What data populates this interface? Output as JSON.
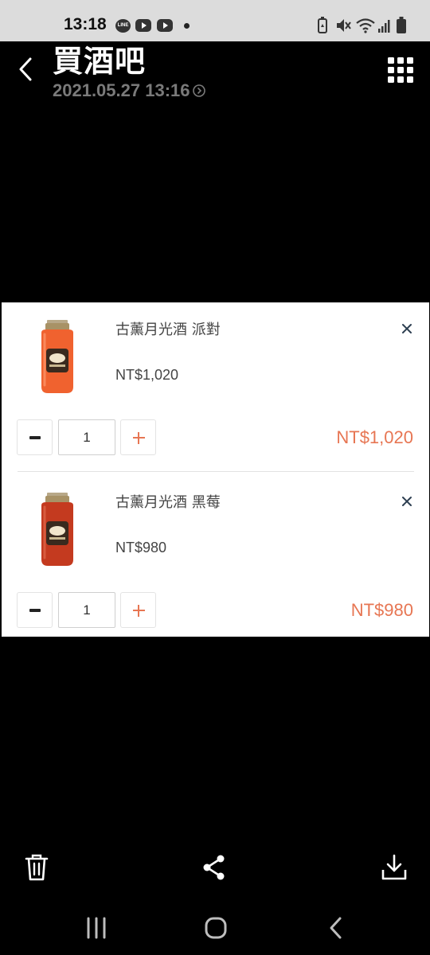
{
  "status_bar": {
    "time": "13:18",
    "app_icons": [
      "line-icon",
      "youtube-icon",
      "youtube-icon"
    ],
    "line_badge": "LINE",
    "right_icons": [
      "battery-saver-icon",
      "mute-icon",
      "wifi-icon",
      "signal-icon",
      "battery-icon"
    ]
  },
  "header": {
    "title": "買酒吧",
    "subtitle": "2021.05.27 13:16"
  },
  "cart": {
    "items": [
      {
        "name": "古薰月光酒 派對",
        "unit_price": "NT$1,020",
        "quantity": "1",
        "line_total": "NT$1,020",
        "image_icon": "moonshine-jar-orange"
      },
      {
        "name": "古薰月光酒 黑莓",
        "unit_price": "NT$980",
        "quantity": "1",
        "line_total": "NT$980",
        "image_icon": "moonshine-jar-red"
      }
    ]
  },
  "colors": {
    "accent": "#e77653",
    "card_bg": "#ffffff",
    "page_bg": "#000000",
    "status_bar_bg": "#dcdcdc",
    "subtitle": "#7a7a7a"
  },
  "toolbar": {
    "icons": [
      "trash-icon",
      "share-icon",
      "download-icon"
    ]
  },
  "nav_bar": {
    "icons": [
      "recent-apps-icon",
      "home-icon",
      "back-icon"
    ]
  }
}
